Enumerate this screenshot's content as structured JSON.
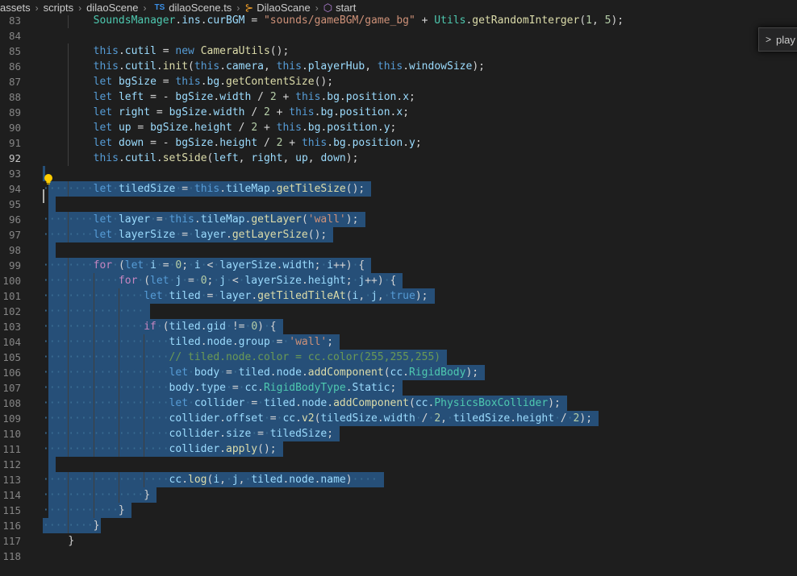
{
  "breadcrumb": {
    "items": [
      {
        "label": "assets",
        "icon": ""
      },
      {
        "label": "scripts",
        "icon": ""
      },
      {
        "label": "dilaoScene",
        "icon": ""
      },
      {
        "label": "dilaoScene.ts",
        "icon": "typescript-file-icon",
        "icon_text": "TS"
      },
      {
        "label": "DilaoScane",
        "icon": "class-icon",
        "icon_text": "⊱"
      },
      {
        "label": "start",
        "icon": "method-cube-icon",
        "icon_text": "⬡"
      }
    ],
    "separator": "›"
  },
  "find_widget": {
    "toggle_icon": "chevron-right-icon",
    "label": "play"
  },
  "editor": {
    "active_line": "92",
    "lightbulb_icon": "lightbulb-icon",
    "lines": [
      {
        "n": "83",
        "text": "        SoundsManager.ins.curBGM = \"sounds/gameBGM/game_bg\" + Utils.getRandomInterger(1, 5);"
      },
      {
        "n": "84",
        "text": ""
      },
      {
        "n": "85",
        "text": "        this.cutil = new CameraUtils();"
      },
      {
        "n": "86",
        "text": "        this.cutil.init(this.camera, this.playerHub, this.windowSize);"
      },
      {
        "n": "87",
        "text": "        let bgSize = this.bg.getContentSize();"
      },
      {
        "n": "88",
        "text": "        let left = - bgSize.width / 2 + this.bg.position.x;"
      },
      {
        "n": "89",
        "text": "        let right = bgSize.width / 2 + this.bg.position.x;"
      },
      {
        "n": "90",
        "text": "        let up = bgSize.height / 2 + this.bg.position.y;"
      },
      {
        "n": "91",
        "text": "        let down = - bgSize.height / 2 + this.bg.position.y;"
      },
      {
        "n": "92",
        "text": "        this.cutil.setSide(left, right, up, down);"
      },
      {
        "n": "93",
        "text": ""
      },
      {
        "n": "94",
        "text": "        let tiledSize = this.tileMap.getTileSize();"
      },
      {
        "n": "95",
        "text": ""
      },
      {
        "n": "96",
        "text": "        let layer = this.tileMap.getLayer('wall');"
      },
      {
        "n": "97",
        "text": "        let layerSize = layer.getLayerSize();"
      },
      {
        "n": "98",
        "text": ""
      },
      {
        "n": "99",
        "text": "        for (let i = 0; i < layerSize.width; i++) {"
      },
      {
        "n": "100",
        "text": "            for (let j = 0; j < layerSize.height; j++) {"
      },
      {
        "n": "101",
        "text": "                let tiled = layer.getTiledTileAt(i, j, true);"
      },
      {
        "n": "102",
        "text": "                "
      },
      {
        "n": "103",
        "text": "                if (tiled.gid != 0) {"
      },
      {
        "n": "104",
        "text": "                    tiled.node.group = 'wall';"
      },
      {
        "n": "105",
        "text": "                    // tiled.node.color = cc.color(255,255,255)"
      },
      {
        "n": "106",
        "text": "                    let body = tiled.node.addComponent(cc.RigidBody);"
      },
      {
        "n": "107",
        "text": "                    body.type = cc.RigidBodyType.Static;"
      },
      {
        "n": "108",
        "text": "                    let collider = tiled.node.addComponent(cc.PhysicsBoxCollider);"
      },
      {
        "n": "109",
        "text": "                    collider.offset = cc.v2(tiledSize.width / 2, tiledSize.height / 2);"
      },
      {
        "n": "110",
        "text": "                    collider.size = tiledSize;"
      },
      {
        "n": "111",
        "text": "                    collider.apply();"
      },
      {
        "n": "112",
        "text": ""
      },
      {
        "n": "113",
        "text": "                    cc.log(i, j, tiled.node.name)    "
      },
      {
        "n": "114",
        "text": "                }"
      },
      {
        "n": "115",
        "text": "            }"
      },
      {
        "n": "116",
        "text": "        }"
      },
      {
        "n": "117",
        "text": "    }"
      },
      {
        "n": "118",
        "text": ""
      }
    ]
  }
}
